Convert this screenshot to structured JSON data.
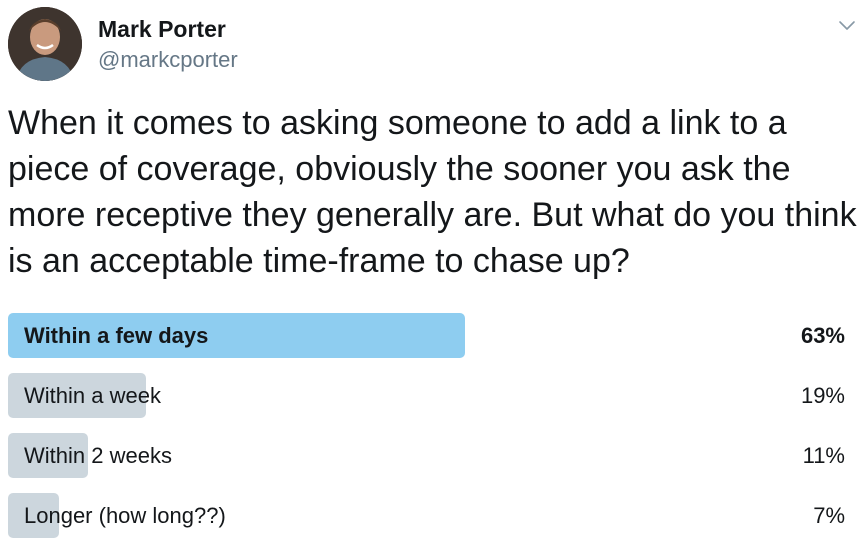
{
  "author": {
    "name": "Mark Porter",
    "handle": "@markcporter",
    "avatar_icon": "profile-photo"
  },
  "tweet": {
    "text": "When it comes to asking someone to add a link to a piece of coverage, obviously the sooner you ask the more receptive they generally are. But what do you think is an acceptable time-frame to chase up?"
  },
  "menu_icon": "chevron-down-icon",
  "colors": {
    "winner_bar": "#8ecdf0",
    "other_bar": "#ccd6dd",
    "handle_text": "#657786"
  },
  "poll": {
    "options": [
      {
        "label": "Within a few days",
        "percent_text": "63%",
        "percent": 63,
        "winner": true
      },
      {
        "label": "Within a week",
        "percent_text": "19%",
        "percent": 19,
        "winner": false
      },
      {
        "label": "Within 2 weeks",
        "percent_text": "11%",
        "percent": 11,
        "winner": false
      },
      {
        "label": "Longer (how long??)",
        "percent_text": "7%",
        "percent": 7,
        "winner": false
      }
    ]
  }
}
